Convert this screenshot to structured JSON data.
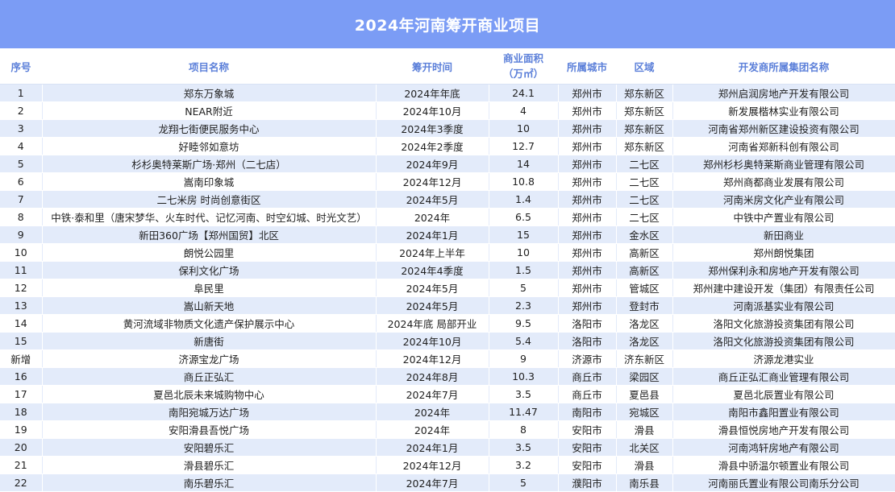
{
  "title": "2024年河南筹开商业项目",
  "headers": {
    "idx": "序号",
    "name": "项目名称",
    "time": "筹开时间",
    "area_line1": "商业面积",
    "area_line2": "（万㎡）",
    "city": "所属城市",
    "district": "区域",
    "developer": "开发商所属集团名称"
  },
  "rows": [
    {
      "idx": "1",
      "name": "郑东万象城",
      "time": "2024年年底",
      "area": "24.1",
      "city": "郑州市",
      "district": "郑东新区",
      "developer": "郑州启润房地产开发有限公司"
    },
    {
      "idx": "2",
      "name": "NEAR附近",
      "time": "2024年10月",
      "area": "4",
      "city": "郑州市",
      "district": "郑东新区",
      "developer": "新发展楷林实业有限公司"
    },
    {
      "idx": "3",
      "name": "龙翔七街便民服务中心",
      "time": "2024年3季度",
      "area": "10",
      "city": "郑州市",
      "district": "郑东新区",
      "developer": "河南省郑州新区建设投资有限公司"
    },
    {
      "idx": "4",
      "name": "好睦邻如意坊",
      "time": "2024年2季度",
      "area": "12.7",
      "city": "郑州市",
      "district": "郑东新区",
      "developer": "河南省郑新科创有限公司"
    },
    {
      "idx": "5",
      "name": "杉杉奥特莱斯广场·郑州（二七店）",
      "time": "2024年9月",
      "area": "14",
      "city": "郑州市",
      "district": "二七区",
      "developer": "郑州杉杉奥特莱斯商业管理有限公司"
    },
    {
      "idx": "6",
      "name": "嵩南印象城",
      "time": "2024年12月",
      "area": "10.8",
      "city": "郑州市",
      "district": "二七区",
      "developer": "郑州商都商业发展有限公司"
    },
    {
      "idx": "7",
      "name": "二七米房 时尚创意街区",
      "time": "2024年5月",
      "area": "1.4",
      "city": "郑州市",
      "district": "二七区",
      "developer": "河南米房文化产业有限公司"
    },
    {
      "idx": "8",
      "name": "中铁·泰和里（唐宋梦华、火车时代、记忆河南、时空幻城、时光文艺）",
      "time": "2024年",
      "area": "6.5",
      "city": "郑州市",
      "district": "二七区",
      "developer": "中铁中产置业有限公司"
    },
    {
      "idx": "9",
      "name": "新田360广场【郑州国贸】北区",
      "time": "2024年1月",
      "area": "15",
      "city": "郑州市",
      "district": "金水区",
      "developer": "新田商业"
    },
    {
      "idx": "10",
      "name": "朗悦公园里",
      "time": "2024年上半年",
      "area": "10",
      "city": "郑州市",
      "district": "高新区",
      "developer": "郑州朗悦集团"
    },
    {
      "idx": "11",
      "name": "保利文化广场",
      "time": "2024年4季度",
      "area": "1.5",
      "city": "郑州市",
      "district": "高新区",
      "developer": "郑州保利永和房地产开发有限公司"
    },
    {
      "idx": "12",
      "name": "阜民里",
      "time": "2024年5月",
      "area": "5",
      "city": "郑州市",
      "district": "管城区",
      "developer": "郑州建中建设开发（集团）有限责任公司"
    },
    {
      "idx": "13",
      "name": "嵩山新天地",
      "time": "2024年5月",
      "area": "2.3",
      "city": "郑州市",
      "district": "登封市",
      "developer": "河南派基实业有限公司"
    },
    {
      "idx": "14",
      "name": "黄河流域非物质文化遗产保护展示中心",
      "time": "2024年底 局部开业",
      "area": "9.5",
      "city": "洛阳市",
      "district": "洛龙区",
      "developer": "洛阳文化旅游投资集团有限公司"
    },
    {
      "idx": "15",
      "name": "新唐街",
      "time": "2024年10月",
      "area": "5.4",
      "city": "洛阳市",
      "district": "洛龙区",
      "developer": "洛阳文化旅游投资集团有限公司"
    },
    {
      "idx": "新增",
      "name": "济源宝龙广场",
      "time": "2024年12月",
      "area": "9",
      "city": "济源市",
      "district": "济东新区",
      "developer": "济源龙港实业"
    },
    {
      "idx": "16",
      "name": "商丘正弘汇",
      "time": "2024年8月",
      "area": "10.3",
      "city": "商丘市",
      "district": "梁园区",
      "developer": "商丘正弘汇商业管理有限公司"
    },
    {
      "idx": "17",
      "name": "夏邑北辰未来城购物中心",
      "time": "2024年7月",
      "area": "3.5",
      "city": "商丘市",
      "district": "夏邑县",
      "developer": "夏邑北辰置业有限公司"
    },
    {
      "idx": "18",
      "name": "南阳宛城万达广场",
      "time": "2024年",
      "area": "11.47",
      "city": "南阳市",
      "district": "宛城区",
      "developer": "南阳市鑫阳置业有限公司"
    },
    {
      "idx": "19",
      "name": "安阳滑县吾悦广场",
      "time": "2024年",
      "area": "8",
      "city": "安阳市",
      "district": "滑县",
      "developer": "滑县恒悦房地产开发有限公司"
    },
    {
      "idx": "20",
      "name": "安阳碧乐汇",
      "time": "2024年1月",
      "area": "3.5",
      "city": "安阳市",
      "district": "北关区",
      "developer": "河南鸿轩房地产有限公司"
    },
    {
      "idx": "21",
      "name": "滑县碧乐汇",
      "time": "2024年12月",
      "area": "3.2",
      "city": "安阳市",
      "district": "滑县",
      "developer": "滑县中骄温尔顿置业有限公司"
    },
    {
      "idx": "22",
      "name": "南乐碧乐汇",
      "time": "2024年7月",
      "area": "5",
      "city": "濮阳市",
      "district": "南乐县",
      "developer": "河南丽氏置业有限公司南乐分公司"
    }
  ],
  "colors": {
    "title_bg": "#7b9cf5",
    "header_text": "#5b7fd9",
    "row_stripe": "#e3ebfa"
  }
}
